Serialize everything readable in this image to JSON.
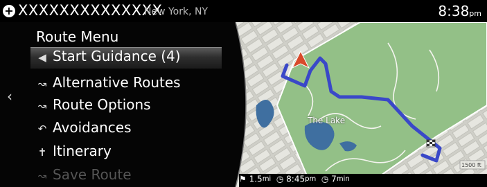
{
  "header": {
    "location_name": "XXXXXXXXXXXXXX",
    "location_city": "New York, NY",
    "time": "8:38",
    "time_suffix": "pm"
  },
  "menu": {
    "title": "Route Menu",
    "items": [
      {
        "label": "Start Guidance (4)",
        "icon": "navigation-arrow-icon"
      },
      {
        "label": "Alternative Routes",
        "icon": "alternative-routes-icon"
      },
      {
        "label": "Route Options",
        "icon": "route-options-icon"
      },
      {
        "label": "Avoidances",
        "icon": "avoidances-icon"
      },
      {
        "label": "Itinerary",
        "icon": "itinerary-icon"
      },
      {
        "label": "Save Route",
        "icon": "save-route-icon"
      }
    ]
  },
  "map": {
    "lake_label": "The Lake",
    "scale_label": "1500 ft"
  },
  "trip": {
    "distance": "1.5",
    "distance_unit": "mi",
    "eta": "8:45",
    "eta_suffix": "pm",
    "duration": "7",
    "duration_unit": "min"
  },
  "colors": {
    "route": "#3a48c8",
    "park": "#8fbd84",
    "lake": "#3f6fa0"
  }
}
